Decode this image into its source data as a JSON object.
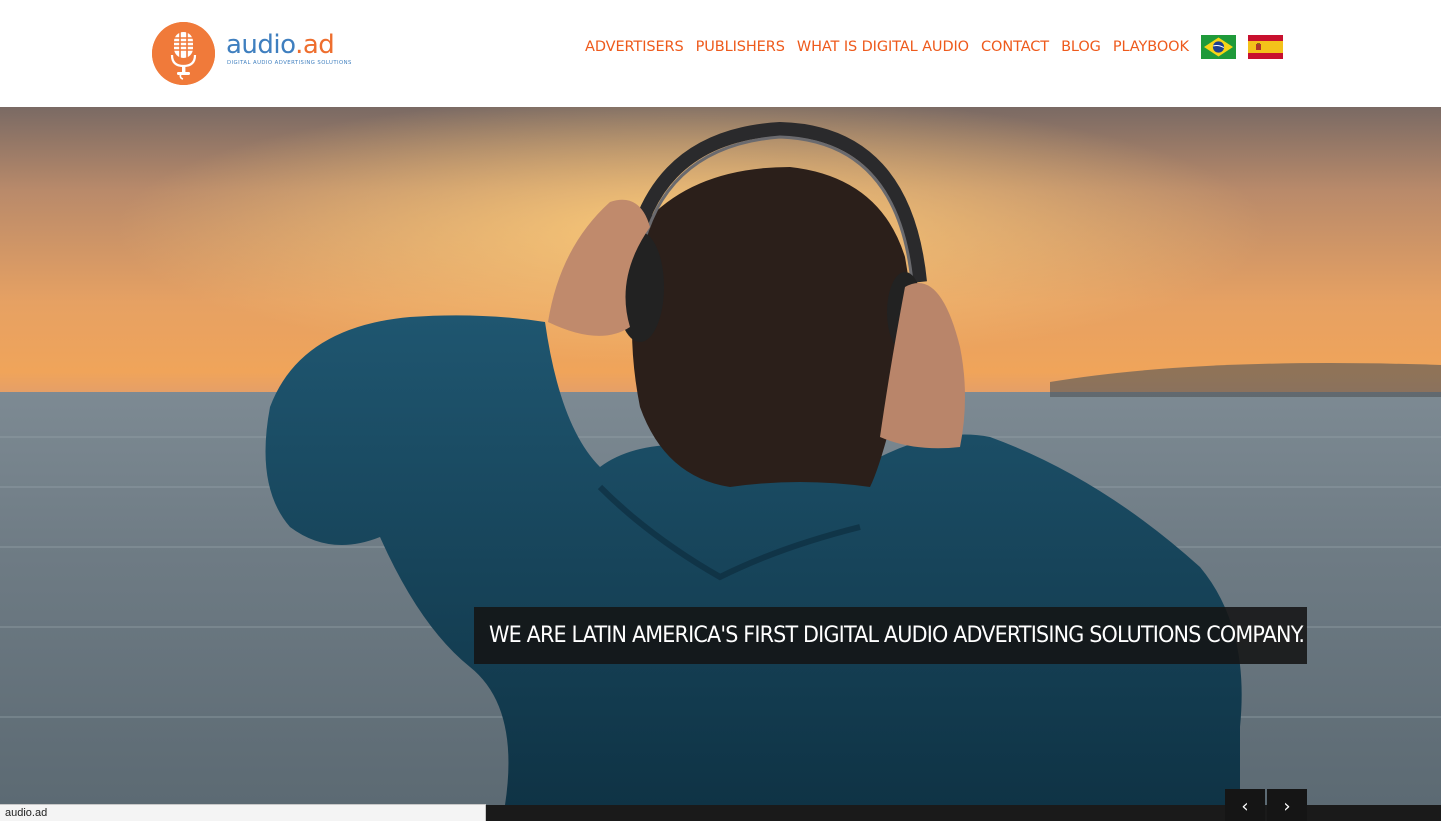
{
  "header": {
    "logo": {
      "brand_part1": "audio",
      "brand_part2": ".ad",
      "tagline": "DIGITAL AUDIO ADVERTISING SOLUTIONS",
      "icon": "microphone-icon"
    },
    "nav": [
      {
        "label": "ADVERTISERS"
      },
      {
        "label": "PUBLISHERS"
      },
      {
        "label": "WHAT IS DIGITAL AUDIO"
      },
      {
        "label": "CONTACT"
      },
      {
        "label": "BLOG"
      },
      {
        "label": "PLAYBOOK"
      }
    ],
    "flags": [
      "brazil-flag-icon",
      "spain-flag-icon"
    ]
  },
  "hero": {
    "caption": "WE ARE LATIN AMERICA'S FIRST DIGITAL AUDIO ADVERTISING SOLUTIONS COMPANY.",
    "prev_icon": "chevron-left-icon",
    "next_icon": "chevron-right-icon",
    "prev_glyph": "‹",
    "next_glyph": "›"
  },
  "status_bar": {
    "text": "audio.ad"
  },
  "colors": {
    "accent": "#ee5a1c",
    "logo_blue": "#3f7fbf",
    "logo_orange": "#f07a3a"
  }
}
